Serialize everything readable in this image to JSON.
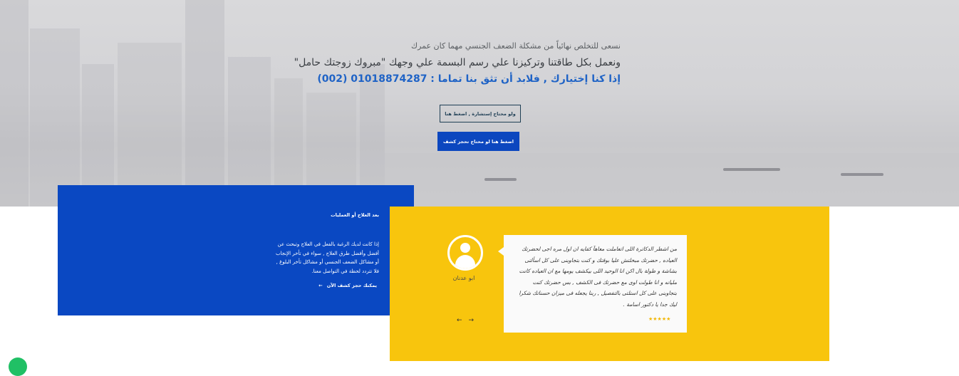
{
  "hero": {
    "line1": "نسعى للتخلص نهائياً من مشكلة الضعف الجنسي مهما كان عمرك",
    "line2": "ونعمل بكل طاقتنا وتركيزنا علي رسم البسمة علي وجهك \"مبروك زوجتك حامل\"",
    "line3": "إذا كنا إختيارك , فلابد أن تثق بنا تماما : 01018874287 (002)",
    "consult_button": "ولو محتاج إستشارة , اضغط هنا",
    "book_button": "اضغط هنا لو محتاج تحجز كشف"
  },
  "blue_card": {
    "title": "بعد العلاج أو العمليات",
    "text": "إذا كانت لديك الرغبة بالفعل في العلاج وتبحث عن أفضل وأفضل طرق العلاج , سواء في تأخر الإنجاب أو مشاكل الضعف الجنسي أو مشاكل تأخر البلوغ , فلا تتردد لحظة في التواصل معنا.",
    "link_label": "يمكنك حجز كشف الآن",
    "link_arrow": "←"
  },
  "testimonial": {
    "text": "من اشطر الدكاترة اللى اتعاملت معاهآ كفايه ان اول مره اجى لحضرتك العياده , حضرتك مبخلتش عليا بوقتك و كنت بتجاوبنى على كل اسألتى بشاشة و طولة بال اكن انا الوحيد اللى بيكشف يومها مع ان العياده كانت مليانه و انا طولت اوى مع حضرتك فى الكشف , بس حضرتك كنت بتجاوبنى على كل استلتى بالتفصيل , ربنا يجعله فى ميزان حسناتك شكرا ليك جدا يا دكتور اسامة .",
    "stars": "★★★★★",
    "reviewer": "ابو عدنان",
    "prev_arrow": "←",
    "next_arrow": "→"
  },
  "colors": {
    "blue": "#0a48c2",
    "yellow": "#f8c50d",
    "accent_text": "#1f63c6"
  },
  "icons": [
    "user-avatar-icon",
    "arrow-left-icon",
    "arrow-right-icon",
    "star-icon",
    "chat-icon"
  ]
}
